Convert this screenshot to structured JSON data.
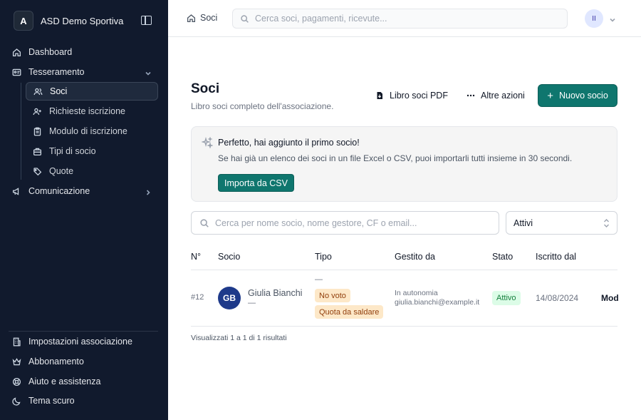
{
  "sidebar": {
    "brand_initial": "A",
    "brand_name": "ASD Demo Sportiva",
    "nav": {
      "dashboard": "Dashboard",
      "tesseramento": "Tesseramento",
      "comunicazione": "Comunicazione"
    },
    "sub_items": [
      "Soci",
      "Richieste iscrizione",
      "Modulo di iscrizione",
      "Tipi di socio",
      "Quote"
    ],
    "bottom": [
      "Impostazioni associazione",
      "Abbonamento",
      "Aiuto e assistenza",
      "Tema scuro"
    ]
  },
  "topbar": {
    "breadcrumb": "Soci",
    "search_placeholder": "Cerca soci, pagamenti, ricevute...",
    "avatar_initials": "II"
  },
  "page": {
    "title": "Soci",
    "subtitle": "Libro soci completo dell'associazione.",
    "btn_pdf": "Libro soci PDF",
    "btn_more": "Altre azioni",
    "btn_new": "Nuovo socio"
  },
  "callout": {
    "title": "Perfetto, hai aggiunto il primo socio!",
    "text": "Se hai già un elenco dei soci in un file Excel o CSV, puoi importarli tutti insieme in 30 secondi.",
    "button": "Importa da CSV"
  },
  "filters": {
    "search_placeholder": "Cerca per nome socio, nome gestore, CF o email...",
    "status_value": "Attivi"
  },
  "table": {
    "headers": [
      "N°",
      "Socio",
      "Tipo",
      "Gestito da",
      "Stato",
      "Iscritto dal"
    ],
    "rows": [
      {
        "number": "#12",
        "initials": "GB",
        "name": "Giulia Bianchi",
        "sub": "—",
        "type_dash": "—",
        "badges": [
          "No voto",
          "Quota da saldare"
        ],
        "managed_line1": "In autonomia",
        "managed_line2": "giulia.bianchi@example.it",
        "status": "Attivo",
        "joined": "14/08/2024",
        "action": "Mod"
      }
    ],
    "footer": "Visualizzati 1 a 1 di 1 risultati"
  },
  "colors": {
    "sidebar_bg": "#111a2d",
    "primary": "#0f766e",
    "badge_warning": "#fde8c8",
    "badge_success": "#dcfce7"
  }
}
